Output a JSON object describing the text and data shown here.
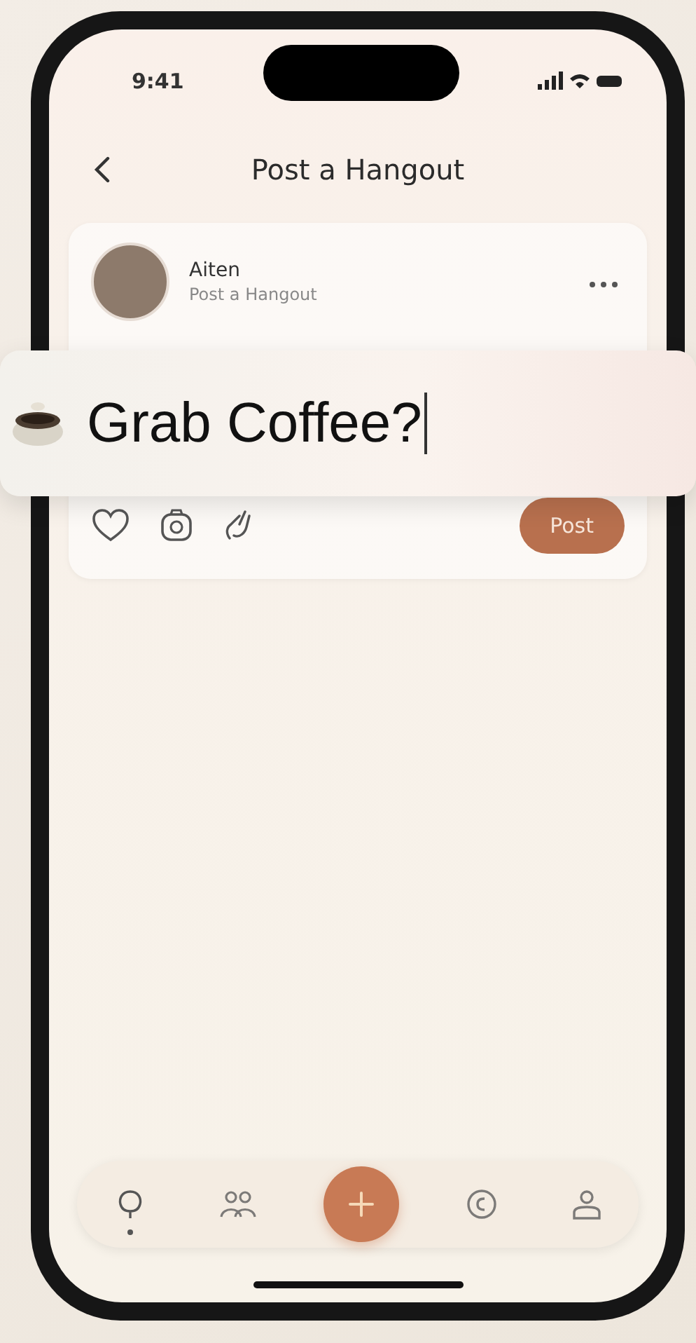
{
  "status_bar": {
    "time": "9:41"
  },
  "header": {
    "title": "Post a Hangout"
  },
  "post_card": {
    "author": "Aiten",
    "subtitle": "Post a Hangout",
    "composer": {
      "value": "Grab Coffee?"
    },
    "post_button": "Post"
  },
  "nav": [
    {
      "kind": "home",
      "selected": true
    },
    {
      "kind": "people",
      "selected": false
    },
    {
      "kind": "add",
      "selected": false
    },
    {
      "kind": "coin",
      "selected": false
    },
    {
      "kind": "profile",
      "selected": false
    }
  ]
}
